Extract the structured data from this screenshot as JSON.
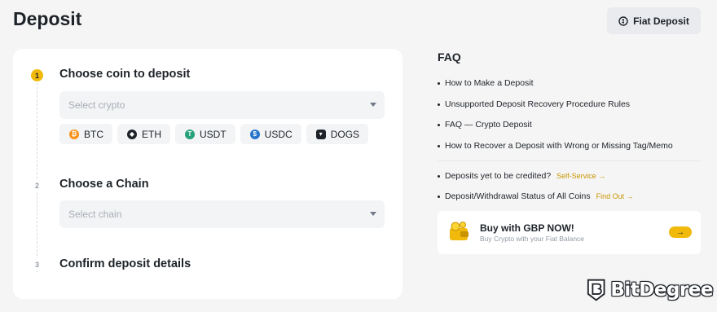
{
  "page": {
    "title": "Deposit"
  },
  "header": {
    "fiat_deposit_label": "Fiat Deposit"
  },
  "steps": [
    {
      "number": "1",
      "title": "Choose coin to deposit",
      "select_placeholder": "Select crypto"
    },
    {
      "number": "2",
      "title": "Choose a Chain",
      "select_placeholder": "Select chain"
    },
    {
      "number": "3",
      "title": "Confirm deposit details"
    }
  ],
  "coins": [
    {
      "label": "BTC",
      "color": "#f7931a",
      "icon": "bitcoin-icon"
    },
    {
      "label": "ETH",
      "color": "#1e2329",
      "icon": "ethereum-icon"
    },
    {
      "label": "USDT",
      "color": "#26a17b",
      "icon": "tether-icon"
    },
    {
      "label": "USDC",
      "color": "#2775ca",
      "icon": "usdc-icon"
    },
    {
      "label": "DOGS",
      "color": "#1e2329",
      "icon": "dogs-icon"
    }
  ],
  "faq": {
    "title": "FAQ",
    "items": [
      "How to Make a Deposit",
      "Unsupported Deposit Recovery Procedure Rules",
      "FAQ — Crypto Deposit",
      "How to Recover a Deposit with Wrong or Missing Tag/Memo"
    ],
    "extra": [
      {
        "text": "Deposits yet to be credited?",
        "link": "Self-Service →"
      },
      {
        "text": "Deposit/Withdrawal Status of All Coins",
        "link": "Find Out →"
      }
    ]
  },
  "promo": {
    "title": "Buy with GBP NOW!",
    "subtitle": "Buy Crypto with your Fiat Balance",
    "arrow": "→"
  },
  "watermark": {
    "text": "BitDegree"
  },
  "colors": {
    "accent": "#f0b90b",
    "link": "#c99400",
    "background": "#f5f5f5"
  }
}
